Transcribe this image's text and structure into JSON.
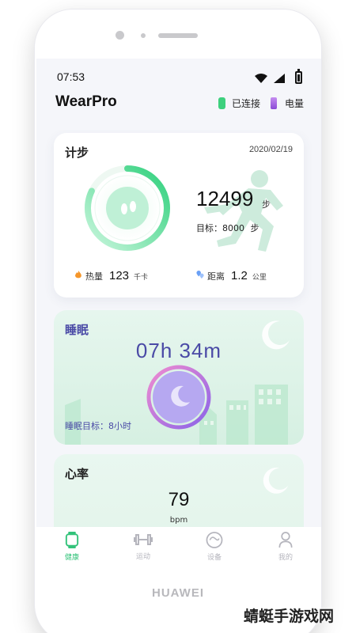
{
  "device": {
    "brand": "HUAWEI"
  },
  "status_bar": {
    "time": "07:53"
  },
  "header": {
    "app_title": "WearPro",
    "connection_label": "已连接",
    "battery_label": "电量"
  },
  "steps_card": {
    "title": "计步",
    "date": "2020/02/19",
    "steps": "12499",
    "steps_unit": "步",
    "goal_label": "目标：",
    "goal_value": "8000",
    "goal_unit": "步",
    "progress_fraction": 0.82,
    "calories_label": "热量",
    "calories_value": "123",
    "calories_unit": "千卡",
    "distance_label": "距离",
    "distance_value": "1.2",
    "distance_unit": "公里"
  },
  "sleep_card": {
    "title": "睡眠",
    "duration": "07h 34m",
    "goal_text": "睡眠目标：8小时"
  },
  "heart_card": {
    "title": "心率",
    "value": "79",
    "unit": "bpm"
  },
  "tabs": [
    {
      "label": "健康",
      "icon": "watch-icon",
      "active": true
    },
    {
      "label": "运动",
      "icon": "dumbbell-icon",
      "active": false
    },
    {
      "label": "设备",
      "icon": "device-icon",
      "active": false
    },
    {
      "label": "我的",
      "icon": "profile-icon",
      "active": false
    }
  ],
  "colors": {
    "accent_green": "#33c37a",
    "sleep_purple": "#4a4aa6",
    "ring_gradient_start": "#a4f0c8",
    "ring_gradient_end": "#2fd07c"
  },
  "watermark": "蜻蜓手游戏网"
}
